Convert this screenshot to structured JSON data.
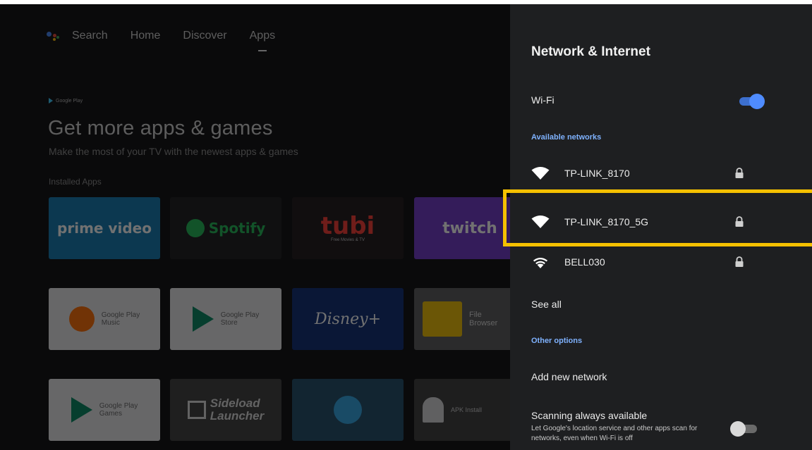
{
  "background": {
    "nav": {
      "search": "Search",
      "home": "Home",
      "discover": "Discover",
      "apps": "Apps"
    },
    "google_play_badge": "Google Play",
    "hero_title": "Get more apps & games",
    "hero_subtitle": "Make the most of your TV with the newest apps & games",
    "row_label": "Installed Apps",
    "apps_row1": [
      {
        "label": "prime video",
        "color": "#00a8e1"
      },
      {
        "label": "Spotify",
        "color": "#1db954"
      },
      {
        "label": "tubi",
        "sub": "Free Movies & TV",
        "color": "#fa382f"
      },
      {
        "label": "twitch",
        "color": "#9146ff"
      }
    ],
    "apps_row2": [
      {
        "label": "Google Play",
        "label2": "Music"
      },
      {
        "label": "Google Play",
        "label2": "Store"
      },
      {
        "label": "Disney+"
      },
      {
        "label": "File",
        "label2": "Browser"
      }
    ],
    "apps_row3": [
      {
        "label": "Google Play",
        "label2": "Games"
      },
      {
        "label": "Sideload",
        "label2": "Launcher"
      },
      {
        "label": ""
      },
      {
        "label": "APK Install"
      }
    ]
  },
  "panel": {
    "title": "Network & Internet",
    "wifi_label": "Wi-Fi",
    "wifi_on": true,
    "available_header": "Available networks",
    "networks": [
      {
        "ssid": "TP-LINK_8170",
        "icon": "wifi-icon",
        "secured": true
      },
      {
        "ssid": "TP-LINK_8170_5G",
        "icon": "wifi-icon",
        "secured": true,
        "highlighted": true
      },
      {
        "ssid": "BELL030",
        "icon": "wifi-icon",
        "secured": true
      }
    ],
    "see_all": "See all",
    "other_header": "Other options",
    "add_network": "Add new network",
    "scanning_title": "Scanning always available",
    "scanning_desc": "Let Google's location service and other apps scan for networks, even when Wi-Fi is off",
    "scanning_on": false
  },
  "colors": {
    "accent_blue": "#4f8cff",
    "section_header": "#7fb2ff",
    "highlight_border": "#f5c000",
    "panel_bg": "#1e1f21"
  }
}
